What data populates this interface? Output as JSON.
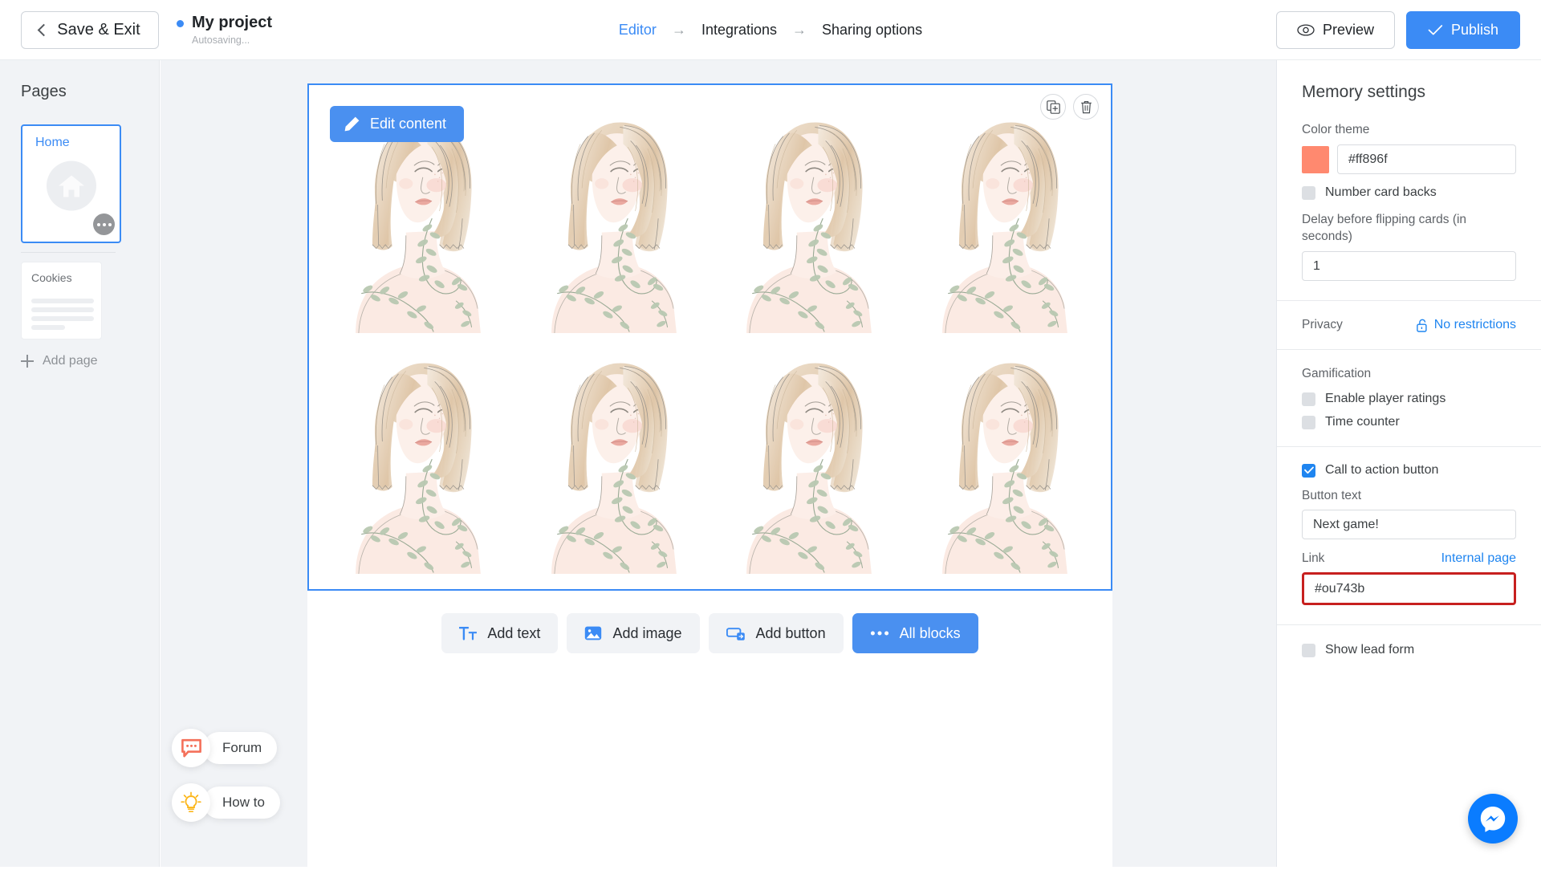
{
  "header": {
    "save_exit_label": "Save & Exit",
    "project_title": "My project",
    "autosaving_label": "Autosaving...",
    "breadcrumb": [
      {
        "label": "Editor",
        "active": true
      },
      {
        "label": "Integrations",
        "active": false
      },
      {
        "label": "Sharing options",
        "active": false
      }
    ],
    "breadcrumb_arrow": "→",
    "preview_label": "Preview",
    "publish_label": "Publish",
    "accent_color": "#3b8bf5"
  },
  "sidebar": {
    "title": "Pages",
    "pages": [
      {
        "label": "Home",
        "selected": true
      },
      {
        "label": "Cookies",
        "selected": false
      }
    ],
    "add_page_label": "Add page"
  },
  "canvas": {
    "edit_content_label": "Edit content",
    "duplicate_icon": "duplicate-icon",
    "delete_icon": "trash-icon",
    "card_count": 8,
    "grid_columns": 4,
    "grid_rows": 2,
    "card_image_name": "woman-illustration-blonde-bob-leaves"
  },
  "add_toolbar": [
    {
      "label": "Add text",
      "icon": "text-format-icon",
      "primary": false
    },
    {
      "label": "Add image",
      "icon": "image-icon",
      "primary": false
    },
    {
      "label": "Add button",
      "icon": "button-icon",
      "primary": false
    },
    {
      "label": "All blocks",
      "icon": "more-dots-icon",
      "primary": true
    }
  ],
  "help": [
    {
      "label": "Forum",
      "icon": "chat-bubble-icon",
      "color": "#f4705a"
    },
    {
      "label": "How to",
      "icon": "lightbulb-icon",
      "color": "#fcb61a"
    }
  ],
  "panel": {
    "title": "Memory settings",
    "color_theme_label": "Color theme",
    "color_theme_value": "#ff896f",
    "color_theme_swatch": "#ff896f",
    "number_card_backs_label": "Number card backs",
    "number_card_backs_checked": false,
    "delay_label": "Delay before flipping cards (in seconds)",
    "delay_value": "1",
    "privacy_label": "Privacy",
    "privacy_value": "No restrictions",
    "privacy_icon": "unlock-icon",
    "gamification_label": "Gamification",
    "enable_player_ratings_label": "Enable player ratings",
    "enable_player_ratings_checked": false,
    "time_counter_label": "Time counter",
    "time_counter_checked": false,
    "cta_label": "Call to action button",
    "cta_checked": true,
    "button_text_label": "Button text",
    "button_text_value": "Next game!",
    "link_label": "Link",
    "internal_page_label": "Internal page",
    "link_value": "#ou743b",
    "link_highlight_color": "#c7201f",
    "show_lead_form_label": "Show lead form",
    "show_lead_form_checked": false
  },
  "messenger": {
    "icon": "messenger-icon",
    "color": "#0a7cff"
  }
}
